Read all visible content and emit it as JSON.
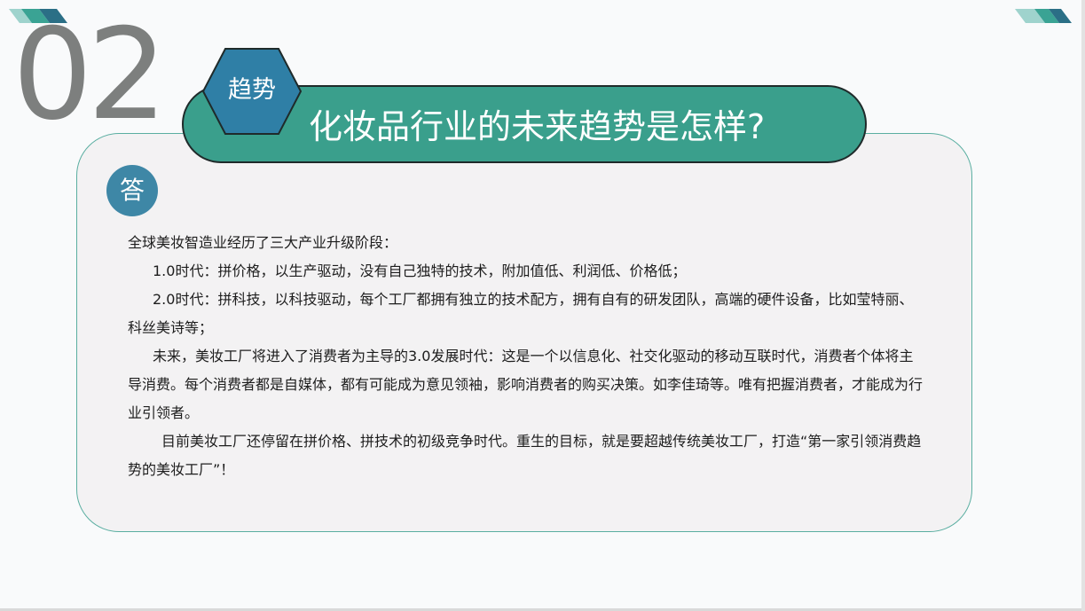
{
  "slide": {
    "section_number": "02",
    "tag_label": "趋势",
    "title": "化妆品行业的未来趋势是怎样?",
    "answer_badge": "答",
    "paragraphs": [
      "全球美妆智造业经历了三大产业升级阶段：",
      "1.0时代：拼价格，以生产驱动，没有自己独特的技术，附加值低、利润低、价格低；",
      "2.0时代：拼科技，以科技驱动，每个工厂都拥有独立的技术配方，拥有自有的研发团队，高端的硬件设备，比如莹特丽、科丝美诗等；",
      "未来，美妆工厂将进入了消费者为主导的3.0发展时代：这是一个以信息化、社交化驱动的移动互联时代，消费者个体将主导消费。每个消费者都是自媒体，都有可能成为意见领袖，影响消费者的购买决策。如李佳琦等。唯有把握消费者，才能成为行业引领者。",
      "目前美妆工厂还停留在拼价格、拼技术的初级竞争时代。重生的目标，就是要超越传统美妆工厂，打造“第一家引领消费趋势的美妆工厂”！"
    ]
  },
  "colors": {
    "teal": "#3a9f8c",
    "blue": "#3e87a6",
    "hexagon": "#2f7fa6",
    "number_gray": "#7d7f7e",
    "card_bg": "#f3f2f3"
  }
}
